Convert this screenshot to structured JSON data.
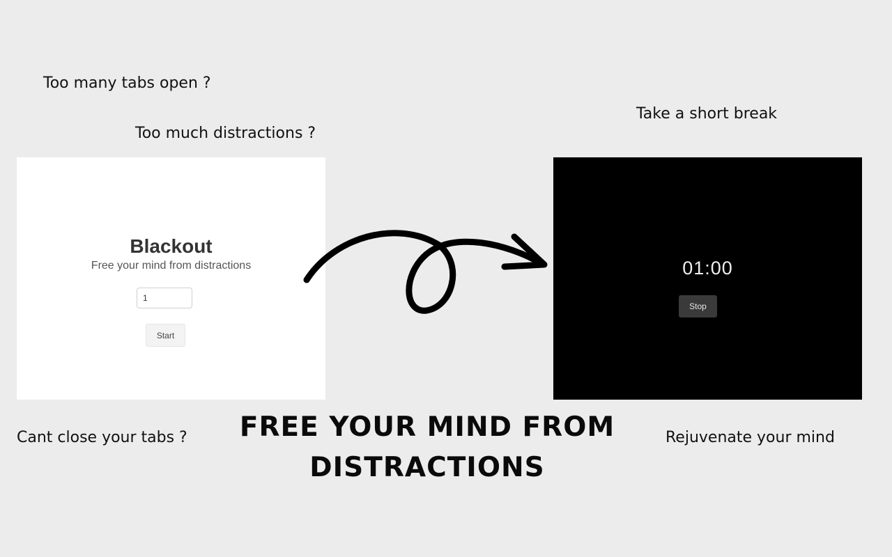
{
  "captions": {
    "too_many_tabs": "Too many tabs open ?",
    "too_much_distractions": "Too much distractions ?",
    "take_break": "Take a short break",
    "cant_close": "Cant close your tabs ?",
    "rejuvenate": "Rejuvenate your mind"
  },
  "left_panel": {
    "app_title": "Blackout",
    "subtitle": "Free your mind from distractions",
    "minutes_value": "1",
    "start_label": "Start"
  },
  "right_panel": {
    "timer": "01:00",
    "stop_label": "Stop"
  },
  "headline": {
    "line1": "FREE YOUR MIND FROM",
    "line2": "DISTRACTIONS"
  },
  "icons": {
    "arrow": "curly-arrow-icon"
  },
  "colors": {
    "background": "#ececec",
    "light_panel": "#ffffff",
    "dark_panel": "#000000",
    "stop_button": "#3a3a3a"
  }
}
